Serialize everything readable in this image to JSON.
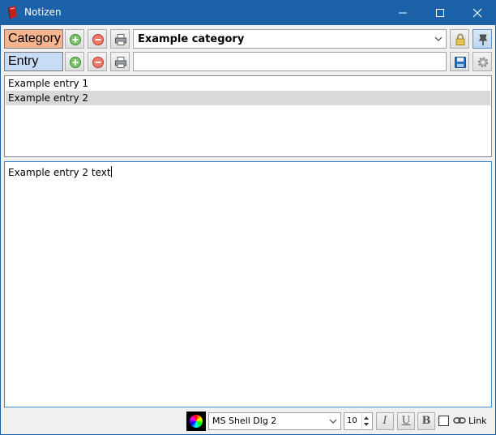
{
  "window": {
    "title": "Notizen",
    "icons": {
      "app": "book-icon",
      "minimize": "minimize-icon",
      "maximize": "maximize-icon",
      "close": "close-icon"
    }
  },
  "category_row": {
    "label": "Category",
    "label_color": "#f7b58f",
    "selected": "Example category",
    "buttons": [
      "add-icon",
      "remove-icon",
      "print-icon",
      "lock-icon",
      "pin-icon"
    ]
  },
  "entry_row": {
    "label": "Entry",
    "label_color": "#c9dcf5",
    "input_value": "",
    "buttons": [
      "add-icon",
      "remove-icon",
      "print-icon",
      "save-icon",
      "gear-icon"
    ]
  },
  "entries": [
    {
      "label": "Example entry 1",
      "selected": false
    },
    {
      "label": "Example entry 2",
      "selected": true
    }
  ],
  "editor": {
    "text": "Example entry 2 text"
  },
  "format_toolbar": {
    "font": "MS Shell Dlg 2",
    "size": "10",
    "italic": "I",
    "underline": "U",
    "bold": "B",
    "link_checked": false,
    "link_label": "Link"
  }
}
